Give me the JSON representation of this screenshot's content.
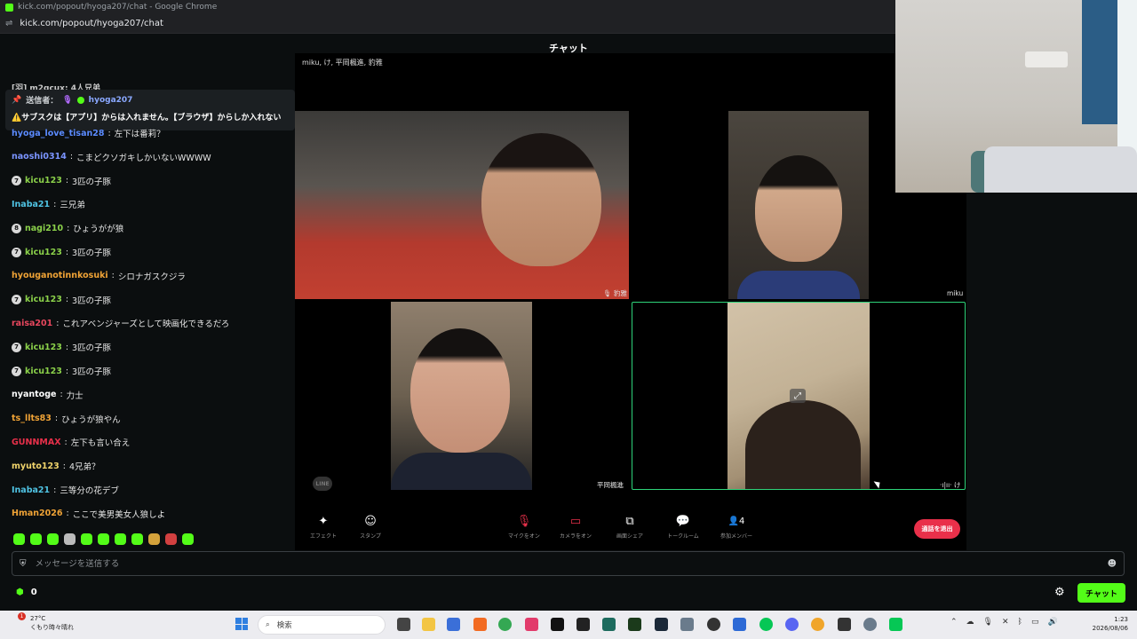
{
  "browser": {
    "title": "kick.com/popout/hyoga207/chat - Google Chrome",
    "url": "kick.com/popout/hyoga207/chat"
  },
  "chat": {
    "header": "チャット",
    "cutoff_message": "[羽] m2gcux: 4人兄弟",
    "pinned": {
      "sender_label": "送信者：",
      "sender": "hyoga207",
      "text": "⚠️サブスクは【アプリ】からは入れません。【ブラウザ】からしか入れない"
    },
    "messages": [
      {
        "user": "hyoga_love_tisan28",
        "color": "#5b8bff",
        "badge": "",
        "text": "左下は番莉？"
      },
      {
        "user": "naoshi0314",
        "color": "#7b94ff",
        "badge": "",
        "text": "こまどクソガキしかいないWWWW"
      },
      {
        "user": "kicu123",
        "color": "#8bd14a",
        "badge": "7",
        "text": "3匹の子豚"
      },
      {
        "user": "Inaba21",
        "color": "#4fc3e3",
        "badge": "",
        "text": "三兄弟"
      },
      {
        "user": "nagi210",
        "color": "#8bd14a",
        "badge": "8",
        "text": "ひょうがが狼"
      },
      {
        "user": "kicu123",
        "color": "#8bd14a",
        "badge": "7",
        "text": "3匹の子豚"
      },
      {
        "user": "hyouganotinnkosuki",
        "color": "#f0a336",
        "badge": "",
        "text": "シロナガスクジラ"
      },
      {
        "user": "kicu123",
        "color": "#8bd14a",
        "badge": "7",
        "text": "3匹の子豚"
      },
      {
        "user": "raisa201",
        "color": "#e8475e",
        "badge": "",
        "text": "これアベンジャーズとして映画化できるだろ"
      },
      {
        "user": "kicu123",
        "color": "#8bd14a",
        "badge": "7",
        "text": "3匹の子豚"
      },
      {
        "user": "kicu123",
        "color": "#8bd14a",
        "badge": "7",
        "text": "3匹の子豚"
      },
      {
        "user": "nyantoge",
        "color": "#ffffff",
        "badge": "",
        "text": "力士"
      },
      {
        "user": "ts_llts83",
        "color": "#f0a336",
        "badge": "",
        "text": "ひょうが狼やん"
      },
      {
        "user": "GUNNMAX",
        "color": "#e8304a",
        "badge": "",
        "text": "左下も言い合え"
      },
      {
        "user": "myuto123",
        "color": "#f0d36b",
        "badge": "",
        "text": "4兄弟？"
      },
      {
        "user": "Inaba21",
        "color": "#4fc3e3",
        "badge": "",
        "text": "三等分の花デブ"
      },
      {
        "user": "Hman2026",
        "color": "#f0a336",
        "badge": "",
        "text": "ここで美男美女人狼しよ"
      }
    ],
    "input_placeholder": "メッセージを送信する",
    "points": "0",
    "send_label": "チャット"
  },
  "call": {
    "title": "miku, け, 平岡楓進, 豹雅",
    "tiles": [
      {
        "name": "豹雅"
      },
      {
        "name": "miku"
      },
      {
        "name": "平岡楓進"
      },
      {
        "name": "·ı|ıı· け"
      }
    ],
    "watermark": "LINE",
    "controls": [
      {
        "icon": "effect-icon",
        "glyph": "✦",
        "label": "エフェクト"
      },
      {
        "icon": "sticker-icon",
        "glyph": "☺",
        "label": "スタンプ"
      },
      {
        "icon": "mic-off-icon",
        "glyph": "🎙",
        "label": "マイクをオン"
      },
      {
        "icon": "camera-off-icon",
        "glyph": "▭",
        "label": "カメラをオン"
      },
      {
        "icon": "screen-share-icon",
        "glyph": "⧉",
        "label": "画面シェア"
      },
      {
        "icon": "talk-room-icon",
        "glyph": "💬",
        "label": "トークルーム"
      },
      {
        "icon": "participants-icon",
        "glyph": "👤4",
        "label": "参加メンバー"
      }
    ],
    "leave_label": "通話を退出"
  },
  "taskbar": {
    "weather_temp": "27°C",
    "weather_text": "くもり時々晴れ",
    "weather_badge": "1",
    "search_placeholder": "検索",
    "time": "1:23",
    "date": "2026/08/06"
  },
  "colors": {
    "kick_green": "#53fc18",
    "leave_red": "#e9304a",
    "speaker_border": "#2ed37a"
  }
}
